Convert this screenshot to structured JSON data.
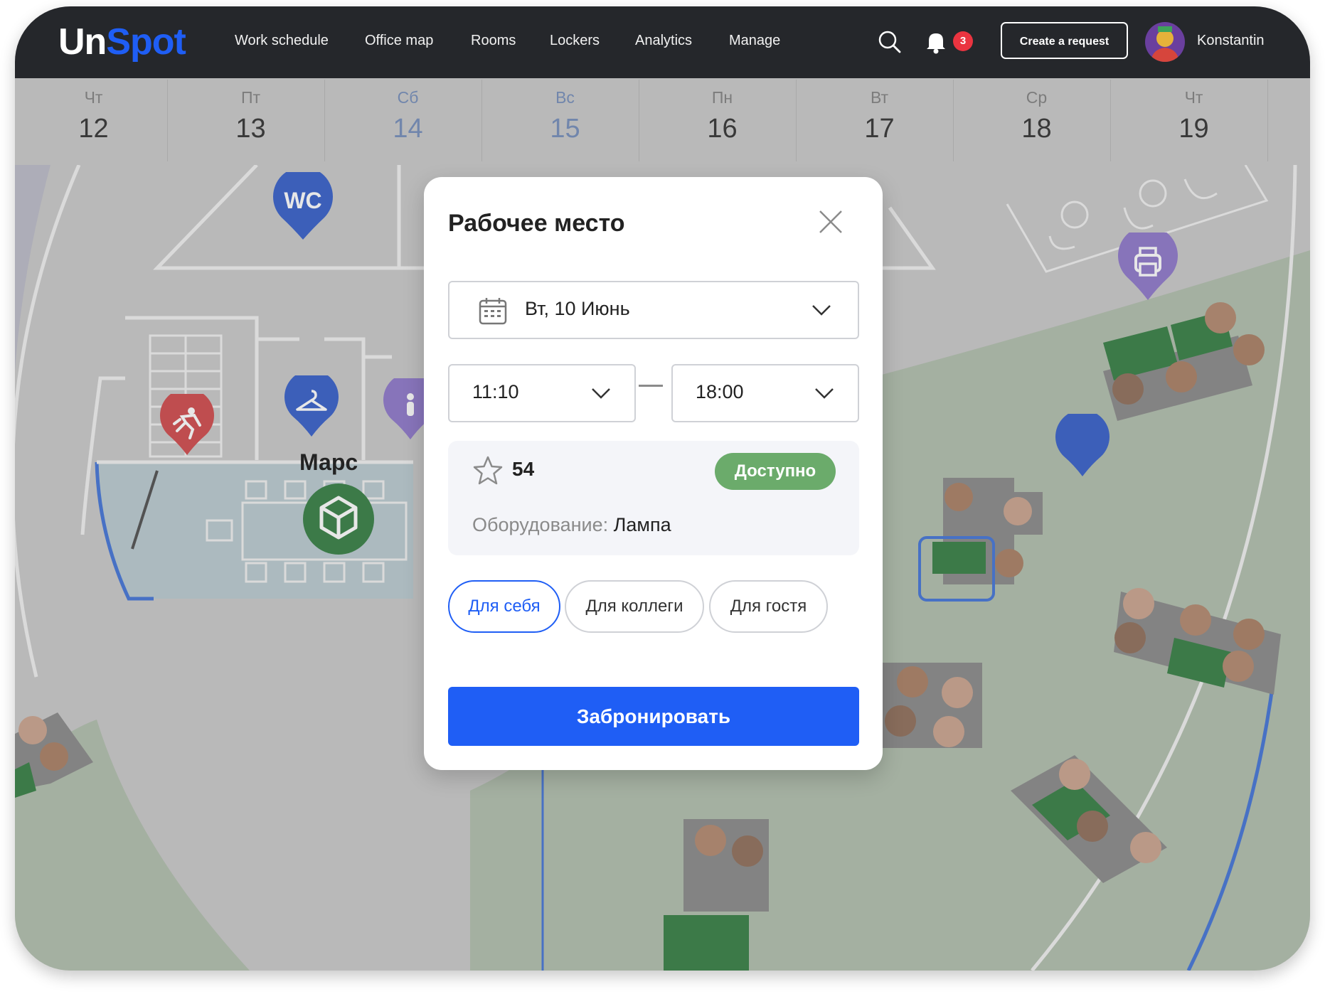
{
  "app": {
    "logo": {
      "part1": "Un",
      "part2": "Spot"
    },
    "brand_color": "#1f5ef5"
  },
  "nav": {
    "items": [
      {
        "label": "Work schedule"
      },
      {
        "label": "Office map"
      },
      {
        "label": "Rooms"
      },
      {
        "label": "Lockers"
      },
      {
        "label": "Analytics"
      },
      {
        "label": "Manage"
      }
    ]
  },
  "header": {
    "search_icon": "search-icon",
    "notifications_icon": "bell-icon",
    "notifications_count": "3",
    "create_request_label": "Create a request",
    "user_name": "Konstantin"
  },
  "dates": [
    {
      "dow": "Чт",
      "num": "12",
      "weekend": false
    },
    {
      "dow": "Пт",
      "num": "13",
      "weekend": false
    },
    {
      "dow": "Сб",
      "num": "14",
      "weekend": true
    },
    {
      "dow": "Вс",
      "num": "15",
      "weekend": true
    },
    {
      "dow": "Пн",
      "num": "16",
      "weekend": false
    },
    {
      "dow": "Вт",
      "num": "17",
      "weekend": false
    },
    {
      "dow": "Ср",
      "num": "18",
      "weekend": false
    },
    {
      "dow": "Чт",
      "num": "19",
      "weekend": false
    }
  ],
  "map": {
    "wc_label": "WC",
    "room_label": "Марс",
    "colors": {
      "floor": "#c7c7c7",
      "zone_green": "#aebcaa",
      "room_blue": "#b8c8cf",
      "desk_green": "#2f7a3e",
      "pin_blue": "#2f59c7",
      "pin_red": "#cf4446",
      "pin_purple": "#8a73c9",
      "pin_green": "#2f7a3e"
    }
  },
  "modal": {
    "title": "Рабочее место",
    "date_value": "Вт, 10 Июнь",
    "time_start": "11:10",
    "time_end": "18:00",
    "seat_number": "54",
    "status": "Доступно",
    "equipment_label": "Оборудование:",
    "equipment_value": "Лампа",
    "chips": [
      {
        "label": "Для себя",
        "active": true
      },
      {
        "label": "Для коллеги",
        "active": false
      },
      {
        "label": "Для гостя",
        "active": false
      }
    ],
    "book_label": "Забронировать",
    "status_color": "#6bab6b"
  }
}
